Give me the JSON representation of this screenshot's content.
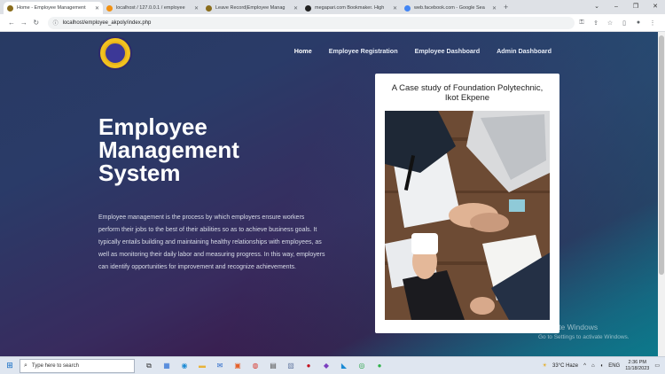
{
  "browser": {
    "tabs": [
      {
        "label": "Home - Employee Management",
        "color": "#8a6d1c",
        "active": true
      },
      {
        "label": "localhost / 127.0.0.1 / employee",
        "color": "#f29111",
        "active": false
      },
      {
        "label": "Leave Record|Employee Manag",
        "color": "#8a6d1c",
        "active": false
      },
      {
        "label": "megapari.com Bookmaker. High",
        "color": "#222222",
        "active": false
      },
      {
        "label": "web.facebook.com - Google Sea",
        "color": "#4285f4",
        "active": false
      }
    ],
    "url": "localhost/employee_akpoly/index.php"
  },
  "nav": {
    "items": [
      {
        "label": "Home",
        "active": true
      },
      {
        "label": "Employee Registration",
        "active": false
      },
      {
        "label": "Employee Dashboard",
        "active": false
      },
      {
        "label": "Admin Dashboard",
        "active": false
      }
    ]
  },
  "hero": {
    "title_lines": [
      "Employee",
      "Management",
      "System"
    ],
    "description": "Employee management is the process by which employers ensure workers perform their jobs to the best of their abilities so as to achieve business goals. It typically entails building and maintaining healthy relationships with employees, as well as monitoring their daily labor and measuring progress. In this way, employers can identify opportunities for improvement and recognize achievements."
  },
  "card": {
    "title": "A Case study of Foundation Polytechnic, Ikot Ekpene"
  },
  "watermark": {
    "line1": "Activate Windows",
    "line2": "Go to Settings to activate Windows."
  },
  "taskbar": {
    "search_placeholder": "Type here to search",
    "weather": "33°C  Haze",
    "lang": "ENG",
    "time": "2:36 PM",
    "date": "11/18/2023"
  }
}
